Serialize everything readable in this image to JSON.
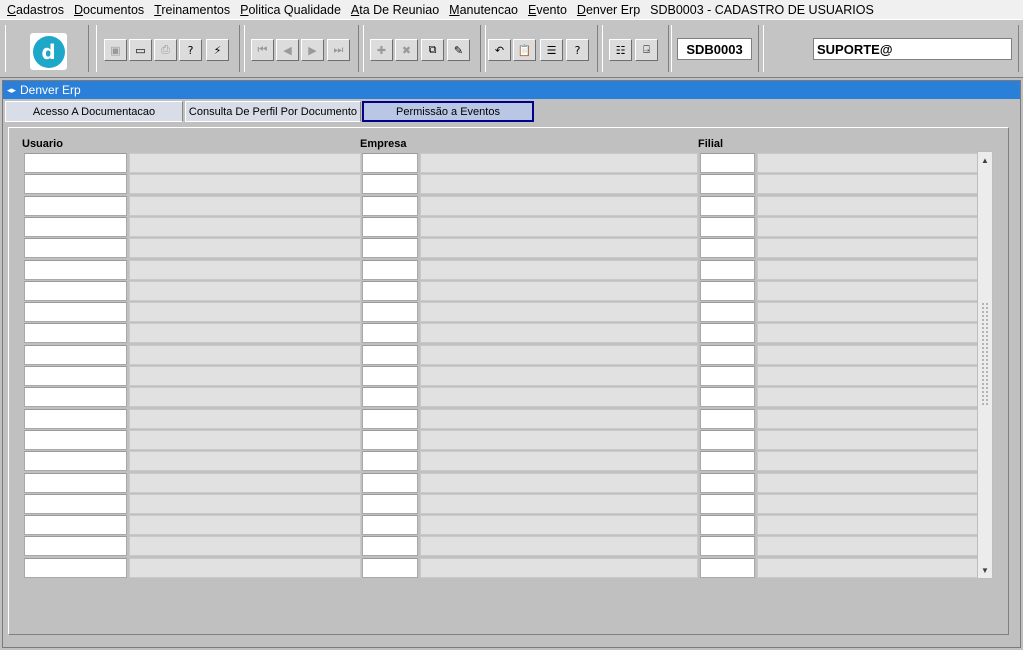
{
  "menu": [
    "Cadastros",
    "Documentos",
    "Treinamentos",
    "Politica Qualidade",
    "Ata De Reuniao",
    "Manutencao",
    "Evento",
    "Denver Erp",
    "SDB0003 - CADASTRO DE USUARIOS"
  ],
  "toolbar": {
    "logo_letter": "d",
    "form_code": "SDB0003",
    "user": "SUPORTE@",
    "buttons": [
      {
        "name": "save-icon",
        "glyph": "▣",
        "disabled": true
      },
      {
        "name": "window-icon",
        "glyph": "▭",
        "disabled": false
      },
      {
        "name": "print-icon",
        "glyph": "⎙",
        "disabled": true
      },
      {
        "name": "query-icon",
        "glyph": "?",
        "disabled": false
      },
      {
        "name": "execute-query-icon",
        "glyph": "⚡",
        "disabled": false
      },
      {
        "name": "first-record-icon",
        "glyph": "⏮",
        "disabled": true
      },
      {
        "name": "previous-record-icon",
        "glyph": "◀",
        "disabled": true
      },
      {
        "name": "next-record-icon",
        "glyph": "▶",
        "disabled": true
      },
      {
        "name": "last-record-icon",
        "glyph": "⏭",
        "disabled": true
      },
      {
        "name": "insert-record-icon",
        "glyph": "✚",
        "disabled": true
      },
      {
        "name": "delete-record-icon",
        "glyph": "✖",
        "disabled": true
      },
      {
        "name": "duplicate-record-icon",
        "glyph": "⧉",
        "disabled": false
      },
      {
        "name": "edit-icon",
        "glyph": "✎",
        "disabled": false
      },
      {
        "name": "undo-icon",
        "glyph": "↶",
        "disabled": false
      },
      {
        "name": "clipboard-icon",
        "glyph": "📋",
        "disabled": false
      },
      {
        "name": "list-icon",
        "glyph": "☰",
        "disabled": false
      },
      {
        "name": "help-icon",
        "glyph": "?",
        "disabled": false
      },
      {
        "name": "menu-icon",
        "glyph": "☷",
        "disabled": false
      },
      {
        "name": "exit-icon",
        "glyph": "⍈",
        "disabled": false
      }
    ]
  },
  "window": {
    "title": "Denver Erp",
    "tabs": [
      {
        "label": "Acesso A Documentacao",
        "active": false
      },
      {
        "label": "Consulta De Perfil Por Documento",
        "active": false
      },
      {
        "label": "Permissão a Eventos",
        "active": true
      }
    ],
    "columns": [
      "Usuario",
      "Empresa",
      "Filial"
    ],
    "row_count": 20
  }
}
